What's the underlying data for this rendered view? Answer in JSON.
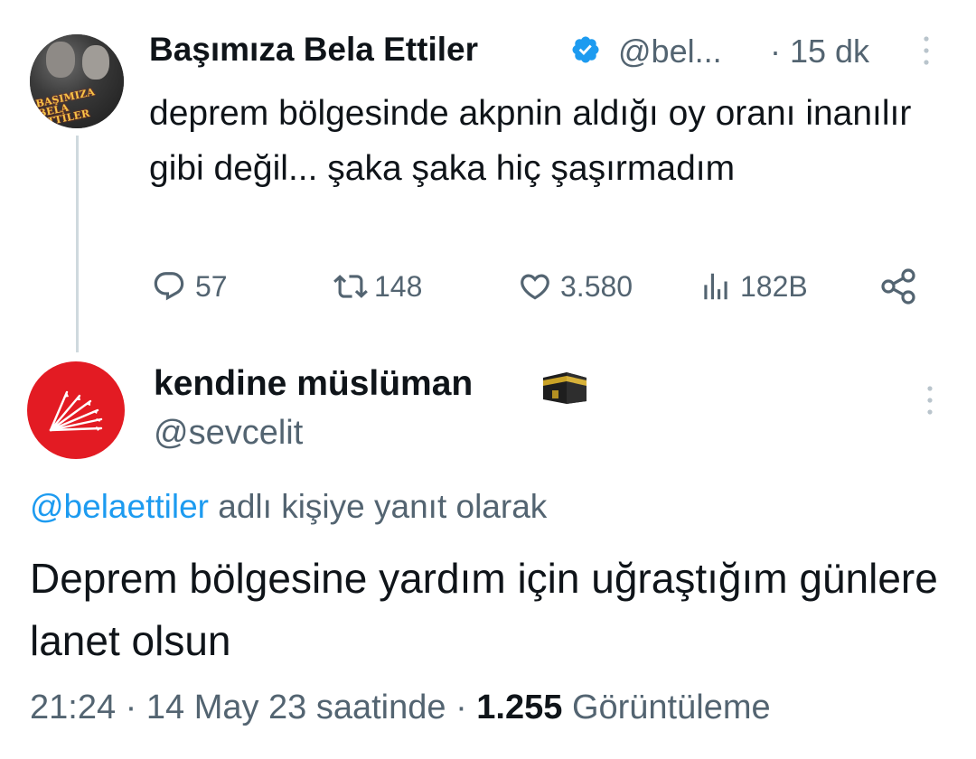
{
  "parent_tweet": {
    "author_name": "Başımıza Bela Ettiler",
    "handle": "@bel...",
    "time": "· 15 dk",
    "avatar_text_line1": "BAŞIMIZA",
    "avatar_text_line2": "BELA ETTİLER",
    "text": "deprem bölgesinde akpnin aldığı oy oranı inanılır gibi değil... şaka şaka hiç şaşırmadım",
    "actions": {
      "replies": "57",
      "retweets": "148",
      "likes": "3.580",
      "views": "182B"
    },
    "icons": [
      "verified-badge-icon",
      "more-icon",
      "reply-icon",
      "retweet-icon",
      "like-icon",
      "views-icon",
      "share-icon"
    ]
  },
  "reply_tweet": {
    "author_name": "kendine müslüman",
    "handle": "@sevcelit",
    "replying_mention": "@belaettiler",
    "replying_suffix": " adlı kişiye yanıt olarak",
    "text": "Deprem bölgesine yardım için uğraştığım günlere lanet olsun",
    "time": "21:24 · 14 May 23 saatinde · ",
    "view_count": "1.255",
    "view_label": " Görüntüleme",
    "icons": [
      "kaaba-emoji-icon",
      "more-icon"
    ]
  },
  "colors": {
    "text": "#0f1419",
    "secondary": "#536471",
    "link": "#1d9bf0",
    "verified": "#1d9bf0",
    "avatar_red": "#e31b23",
    "thread_line": "#cfd9de"
  }
}
